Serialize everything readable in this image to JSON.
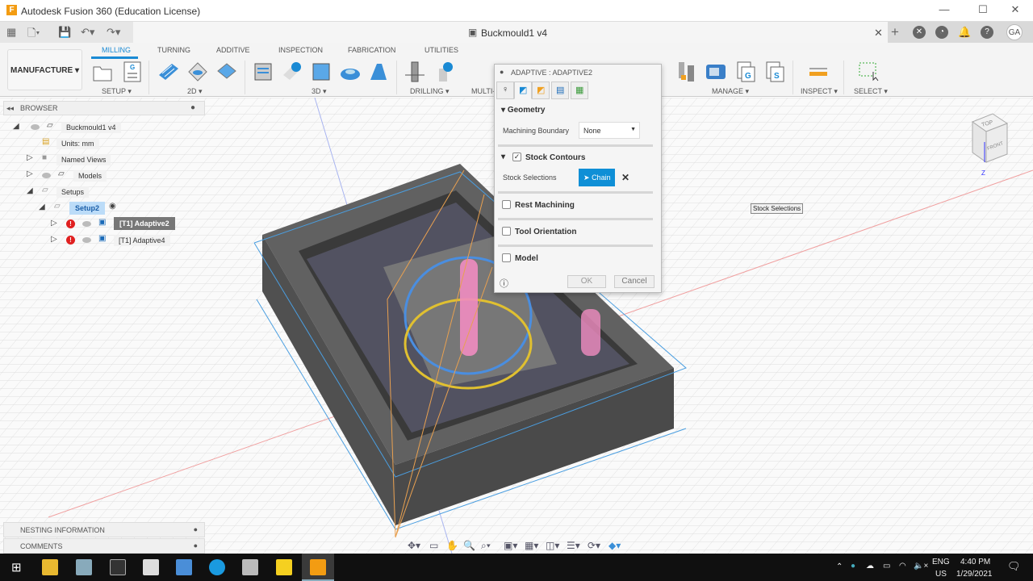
{
  "window": {
    "title": "Autodesk Fusion 360 (Education License)",
    "logo": "F",
    "document_tab": "Buckmould1 v4",
    "user_initials": "GA"
  },
  "toolbar": {
    "workspace": "MANUFACTURE",
    "tabs": [
      "MILLING",
      "TURNING",
      "ADDITIVE",
      "INSPECTION",
      "FABRICATION",
      "UTILITIES"
    ],
    "active_tab": "MILLING",
    "groups": [
      "SETUP",
      "2D",
      "3D",
      "DRILLING",
      "MULTI-",
      "MANAGE",
      "INSPECT",
      "SELECT"
    ]
  },
  "browser": {
    "title": "BROWSER",
    "items": [
      {
        "label": "Buckmould1 v4"
      },
      {
        "label": "Units: mm"
      },
      {
        "label": "Named Views"
      },
      {
        "label": "Models"
      },
      {
        "label": "Setups"
      },
      {
        "label": "Setup2"
      },
      {
        "label": "[T1] Adaptive2",
        "error": true,
        "selected": true
      },
      {
        "label": "[T1] Adaptive4",
        "error": true
      }
    ]
  },
  "dialog": {
    "title": "ADAPTIVE : ADAPTIVE2",
    "tabs": [
      "tool-icon",
      "geometry-icon",
      "heights-icon",
      "passes-icon",
      "linking-icon"
    ],
    "geometry_header": "Geometry",
    "machining_boundary_label": "Machining Boundary",
    "machining_boundary_value": "None",
    "stock_contours_label": "Stock Contours",
    "stock_contours_checked": true,
    "stock_selections_label": "Stock Selections",
    "chain_button": "Chain",
    "rest_machining": "Rest Machining",
    "tool_orientation": "Tool Orientation",
    "model": "Model",
    "ok": "OK",
    "cancel": "Cancel"
  },
  "tooltip": "Stock Selections",
  "viewcube": {
    "top": "TOP",
    "front": "FRONT"
  },
  "bottom_panels": [
    "NESTING INFORMATION",
    "COMMENTS"
  ],
  "taskbar": {
    "lang1": "ENG",
    "lang2": "US",
    "time": "4:40 PM",
    "date": "1/29/2021"
  },
  "colors": {
    "accent": "#1a8ad4",
    "chain_button": "#0f8fd6",
    "error": "#e02020",
    "taskbar": "#101010"
  }
}
